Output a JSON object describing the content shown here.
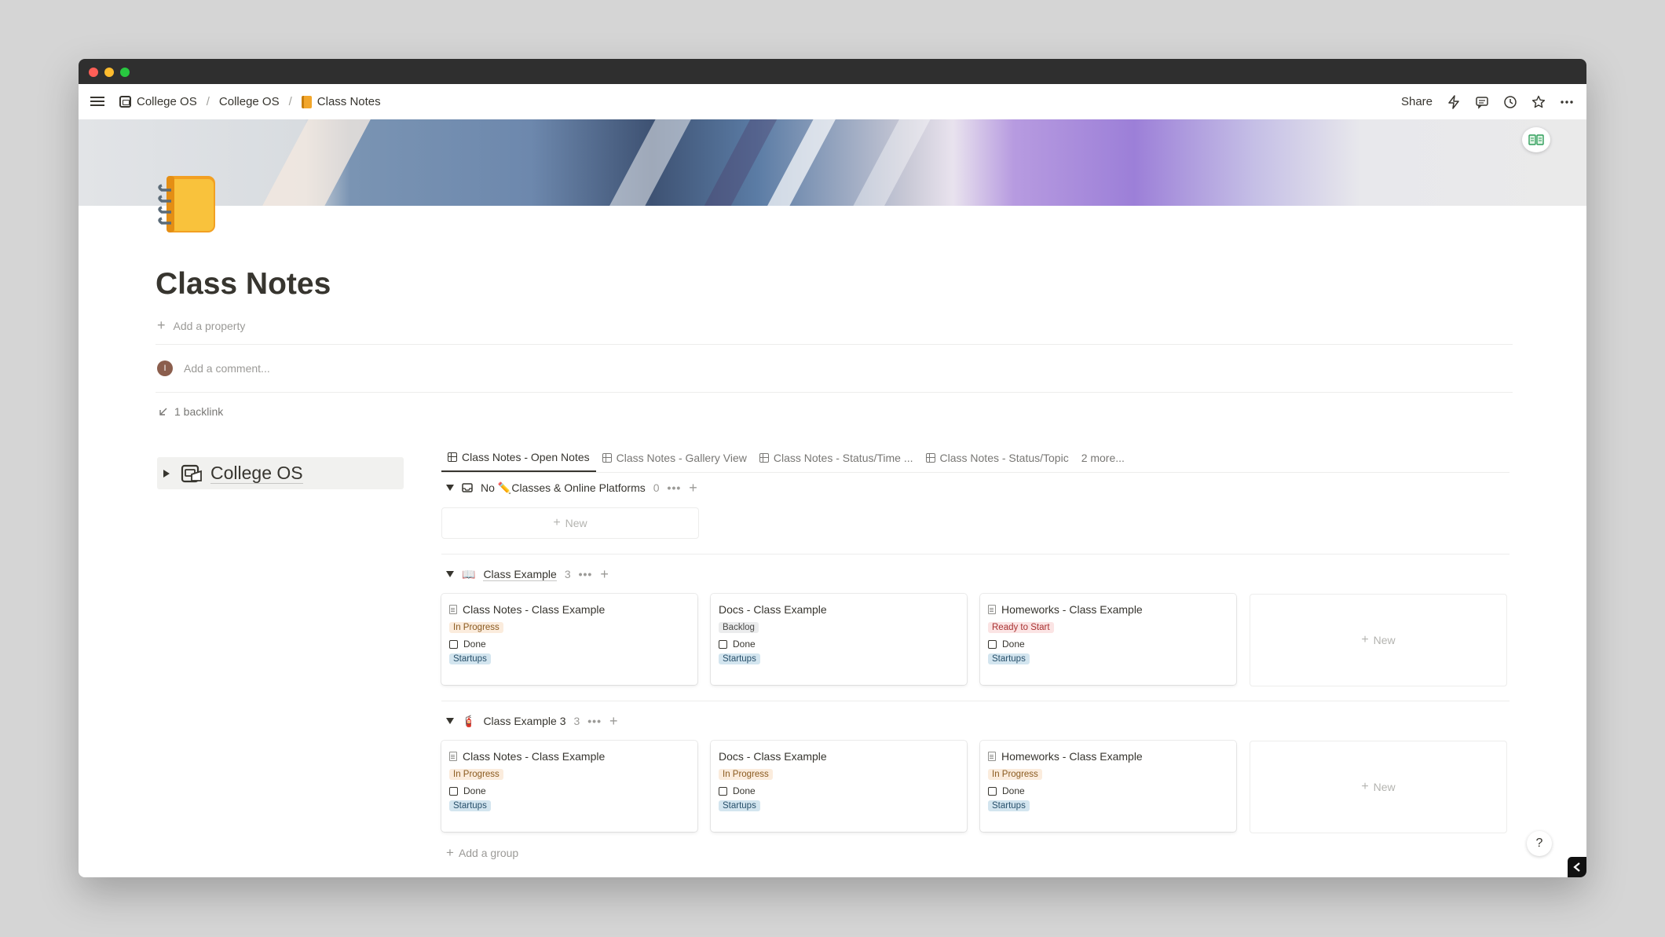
{
  "breadcrumb": [
    {
      "label": "College OS"
    },
    {
      "label": "College OS"
    },
    {
      "label": "Class Notes"
    }
  ],
  "topbar": {
    "share": "Share"
  },
  "page": {
    "title": "Class Notes",
    "add_property": "Add a property",
    "comment_placeholder": "Add a comment...",
    "avatar_initial": "I",
    "backlink": "1 backlink"
  },
  "toggle": {
    "label": "College OS"
  },
  "tabs": [
    {
      "label": "Class Notes - Open Notes"
    },
    {
      "label": "Class Notes - Gallery View"
    },
    {
      "label": "Class Notes - Status/Time ..."
    },
    {
      "label": "Class Notes - Status/Topic"
    },
    {
      "label": "2 more..."
    }
  ],
  "groups": [
    {
      "name": "No",
      "emoji": "✏️",
      "name2": "Classes & Online Platforms",
      "count": "0",
      "new_label": "New"
    },
    {
      "emoji": "📖",
      "name": "Class Example",
      "count": "3",
      "new_label": "New",
      "cards": [
        {
          "title": "Class Notes - Class Example",
          "status": "In Progress",
          "done": "Done",
          "topic": "Startups"
        },
        {
          "title": "Docs - Class Example",
          "status": "Backlog",
          "done": "Done",
          "topic": "Startups"
        },
        {
          "title": "Homeworks - Class Example",
          "status": "Ready to Start",
          "done": "Done",
          "topic": "Startups"
        }
      ]
    },
    {
      "emoji": "🧯",
      "name": "Class Example 3",
      "count": "3",
      "new_label": "New",
      "cards": [
        {
          "title": "Class Notes - Class Example",
          "status": "In Progress",
          "done": "Done",
          "topic": "Startups"
        },
        {
          "title": "Docs - Class Example",
          "status": "In Progress",
          "done": "Done",
          "topic": "Startups"
        },
        {
          "title": "Homeworks - Class Example",
          "status": "In Progress",
          "done": "Done",
          "topic": "Startups"
        }
      ]
    }
  ],
  "add_group": "Add a group",
  "help": "?",
  "plus_glyph": "+",
  "more_glyph": "•••"
}
